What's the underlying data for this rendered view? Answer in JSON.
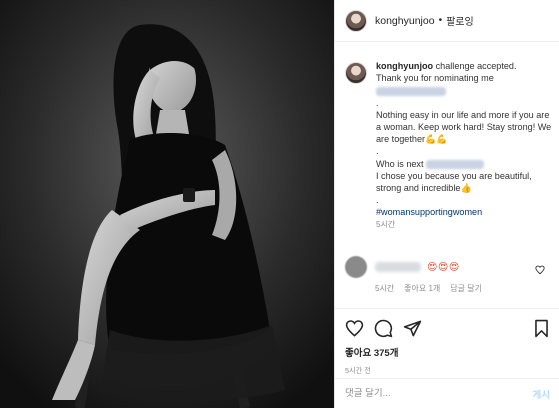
{
  "post": {
    "username": "konghyunjoo",
    "dot": "•",
    "follow_label": "팔로잉",
    "photo_alt": "black and white photograph of a woman in a black dress seated against a dark backdrop"
  },
  "caption": {
    "username": "konghyunjoo",
    "line1": "challenge accepted.",
    "line2": "Thank you for nominating me",
    "dot1": ".",
    "line3": "Nothing easy in our life and more if you are a woman. Keep work hard! Stay strong! We are together",
    "line3_emoji": "💪💪",
    "dot2": ".",
    "line4": "Who is next",
    "line5": "I chose you because you are beautiful, strong and incredible",
    "line5_emoji": "👍",
    "dot3": ".",
    "hashtag": "#womansupportingwomen",
    "time": "5시간"
  },
  "comment": {
    "emojis": "😍😍😍",
    "time": "5시간",
    "likes": "좋아요 1개",
    "reply": "답글 달기"
  },
  "actions": {
    "likes_text": "좋아요 375개",
    "posted_time": "5시간 전"
  },
  "comment_input": {
    "placeholder": "댓글 달기...",
    "post_label": "게시"
  },
  "colors": {
    "link": "#00376b",
    "meta": "#8e8e8e",
    "post_button": "#b3dbff"
  }
}
